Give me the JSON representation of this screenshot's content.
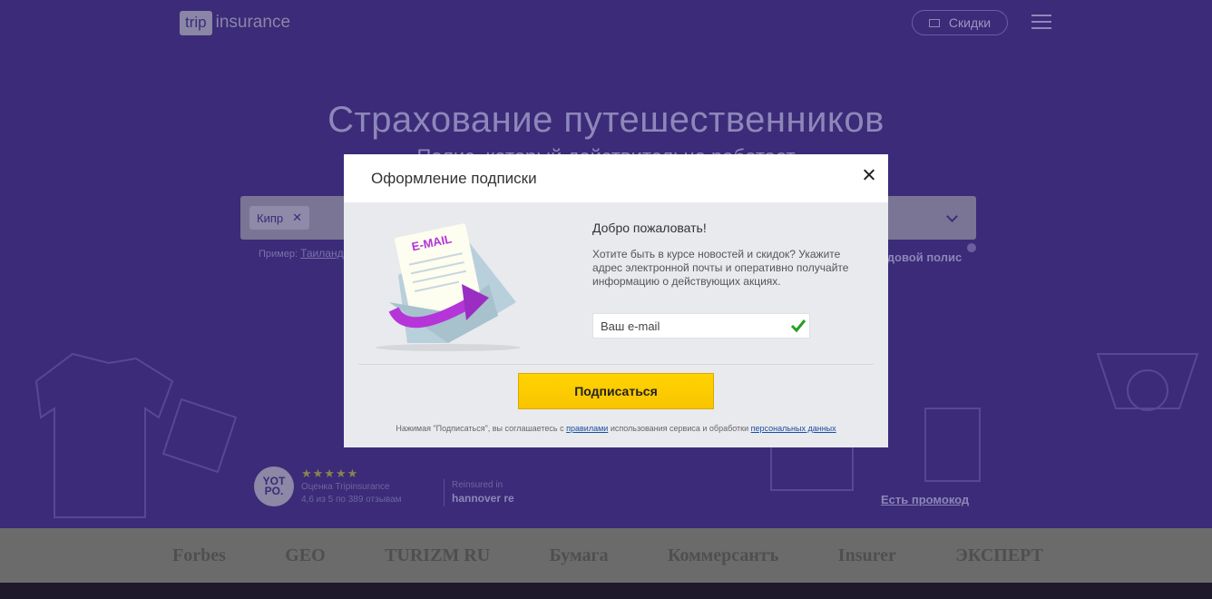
{
  "header": {
    "logo_trip": "trip",
    "logo_insurance": "insurance",
    "discount_label": "Скидки"
  },
  "hero": {
    "title": "Страхование путешественников",
    "subtitle": "Полис, который действительно работает",
    "chip_label": "Кипр",
    "example_label": "Пример:",
    "example_link": "Таиланд",
    "annual_label": "одовой полис"
  },
  "rating": {
    "badge": "YOT PO.",
    "stars": "★★★★★",
    "line1": "Оценка Tripinsurance",
    "line2": "4,6 из 5 по 389 отзывам",
    "reinsured_label": "Reinsured in",
    "reinsured_brand": "hannover re",
    "promo_link": "Есть промокод"
  },
  "press": [
    "Forbes",
    "GEO",
    "TURIZM RU",
    "Бумага",
    "Коммерсантъ",
    "Insurer",
    "ЭКСПЕРТ"
  ],
  "modal": {
    "title": "Оформление подписки",
    "envelope_label": "E-MAIL",
    "welcome": "Добро пожаловать!",
    "description": "Хотите быть в курсе новостей и скидок? Укажите адрес электронной почты и оперативно получайте информацию о действующих акциях.",
    "email_placeholder": "Ваш e-mail",
    "subscribe_label": "Подписаться",
    "legal_prefix": "Нажимая \"Подписаться\", вы соглашаетесь с",
    "legal_rules_link": "правилами",
    "legal_middle": "использования сервиса и обработки",
    "legal_data_link": "персональных данных"
  },
  "colors": {
    "hero_bg": "#3b2b78",
    "accent_button": "#ffd300",
    "check": "#22a020",
    "envelope_arrow": "#b535d8"
  }
}
